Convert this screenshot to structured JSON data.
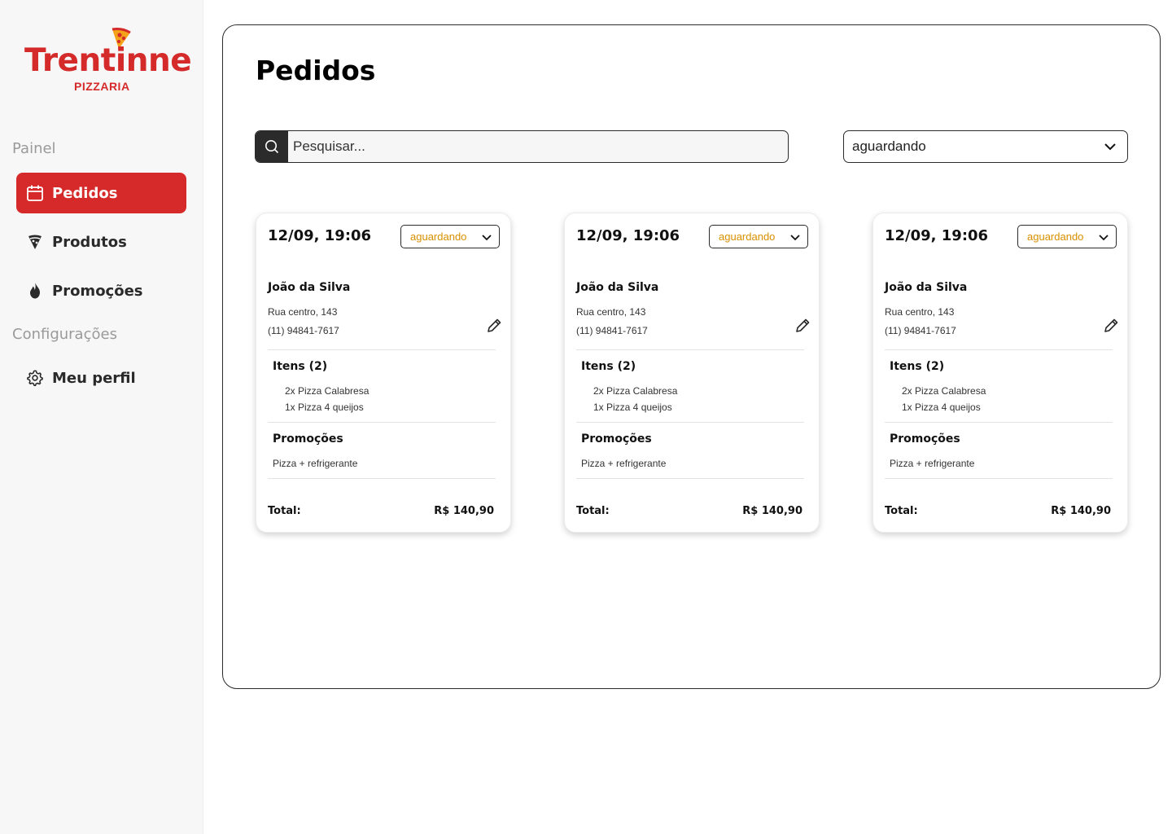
{
  "brand": {
    "name": "Trentinne",
    "subtitle": "PIZZARIA",
    "color": "#d42a2a"
  },
  "sidebar": {
    "sections": [
      {
        "label": "Painel"
      },
      {
        "label": "Configurações"
      }
    ],
    "items": [
      {
        "label": "Pedidos",
        "icon": "calendar-icon",
        "active": true
      },
      {
        "label": "Produtos",
        "icon": "pizza-slice-icon",
        "active": false
      },
      {
        "label": "Promoções",
        "icon": "flame-icon",
        "active": false
      },
      {
        "label": "Meu perfil",
        "icon": "gear-icon",
        "active": false
      }
    ]
  },
  "main": {
    "title": "Pedidos",
    "search": {
      "placeholder": "Pesquisar..."
    },
    "filter": {
      "value": "aguardando"
    }
  },
  "orders": [
    {
      "date": "12/09, 19:06",
      "status": "aguardando",
      "customer": "João da Silva",
      "address": "Rua centro, 143",
      "phone": "(11) 94841-7617",
      "items_title": "Itens (2)",
      "items": [
        "2x Pizza Calabresa",
        "1x Pizza 4 queijos"
      ],
      "promos_title": "Promoções",
      "promos": [
        "Pizza + refrigerante"
      ],
      "total_label": "Total:",
      "total": "R$ 140,90"
    },
    {
      "date": "12/09, 19:06",
      "status": "aguardando",
      "customer": "João da Silva",
      "address": "Rua centro, 143",
      "phone": "(11) 94841-7617",
      "items_title": "Itens (2)",
      "items": [
        "2x Pizza Calabresa",
        "1x Pizza 4 queijos"
      ],
      "promos_title": "Promoções",
      "promos": [
        "Pizza + refrigerante"
      ],
      "total_label": "Total:",
      "total": "R$ 140,90"
    },
    {
      "date": "12/09, 19:06",
      "status": "aguardando",
      "customer": "João da Silva",
      "address": "Rua centro, 143",
      "phone": "(11) 94841-7617",
      "items_title": "Itens (2)",
      "items": [
        "2x Pizza Calabresa",
        "1x Pizza 4 queijos"
      ],
      "promos_title": "Promoções",
      "promos": [
        "Pizza + refrigerante"
      ],
      "total_label": "Total:",
      "total": "R$ 140,90"
    }
  ],
  "colors": {
    "accent": "#d62a2a",
    "status": "#d99000",
    "dark": "#2b2b2b"
  }
}
